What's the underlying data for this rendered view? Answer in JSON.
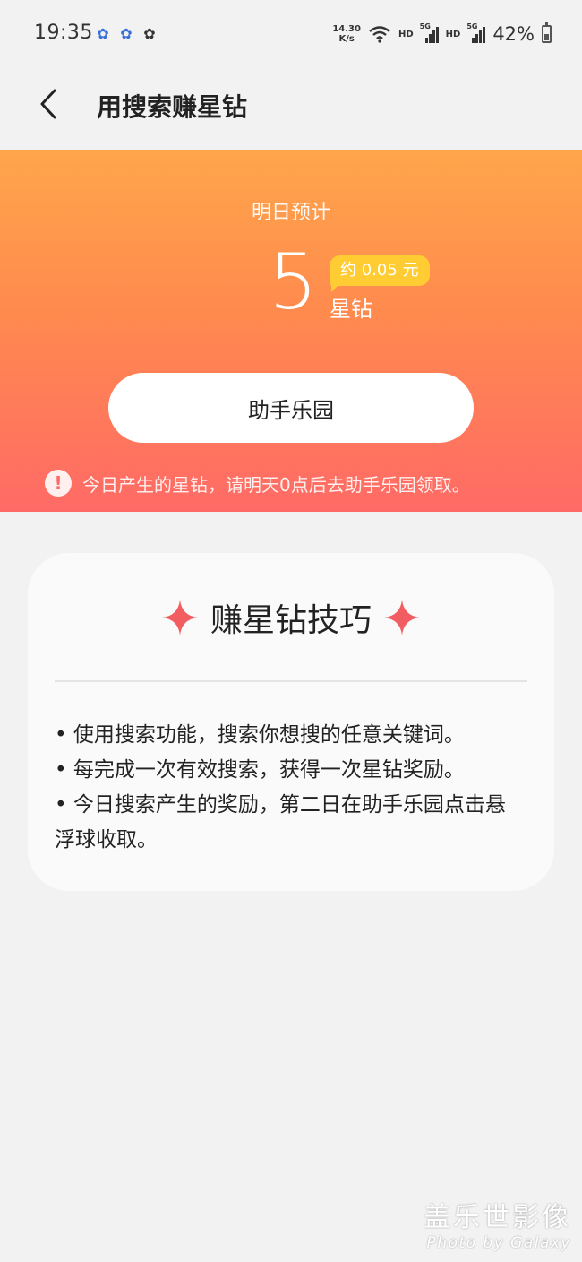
{
  "status_bar": {
    "time": "19:35",
    "net_speed_value": "14.30",
    "net_speed_unit": "K/s",
    "hd_label": "HD",
    "signal_label": "5G",
    "battery_percent": "42%",
    "battery_level": 0.42,
    "left_icons": [
      "baidu-paw-icon",
      "baidu-paw-icon",
      "baidu-du-icon"
    ]
  },
  "header": {
    "title": "用搜索赚星钻"
  },
  "hero": {
    "label": "明日预计",
    "value": "5",
    "approx": "约 0.05 元",
    "unit": "星钻",
    "button_label": "助手乐园",
    "notice": "今日产生的星钻，请明天0点后去助手乐园领取。",
    "gradient_top": "#ffa64b",
    "gradient_bottom": "#ff6a66",
    "badge_color": "#ffcc33"
  },
  "tips": {
    "title": "赚星钻技巧",
    "sparkle_color": "#f25d62",
    "items": [
      "• 使用搜索功能，搜索你想搜的任意关键词。",
      "• 每完成一次有效搜索，获得一次星钻奖励。",
      "• 今日搜索产生的奖励，第二日在助手乐园点击悬浮球收取。"
    ]
  },
  "watermark": {
    "line1": "盖乐世影像",
    "line2": "Photo by Galaxy"
  }
}
